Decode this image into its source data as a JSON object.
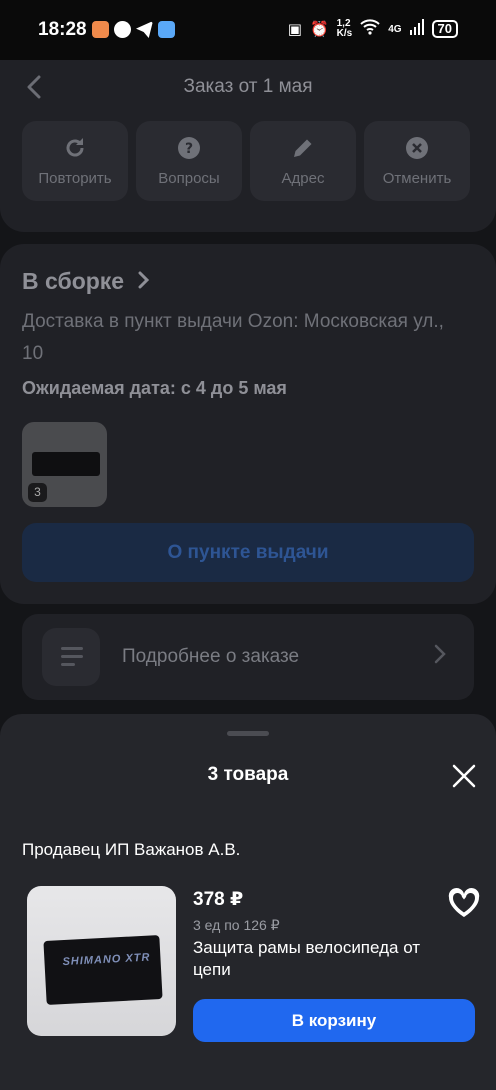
{
  "status_bar": {
    "time": "18:28",
    "network_speed": "1,2\nK/s",
    "network_type": "4G",
    "battery": "70"
  },
  "header": {
    "title": "Заказ от 1 мая"
  },
  "actions": [
    {
      "label": "Повторить",
      "icon": "repeat-icon"
    },
    {
      "label": "Вопросы",
      "icon": "question-icon"
    },
    {
      "label": "Адрес",
      "icon": "pencil-icon"
    },
    {
      "label": "Отменить",
      "icon": "cancel-icon"
    }
  ],
  "order_status": {
    "title": "В сборке",
    "delivery": "Доставка в пункт выдачи Ozon: Московская ул., 10",
    "expected_date": "Ожидаемая дата: с 4 до 5 мая",
    "item_count_badge": "3",
    "pickup_button": "О пункте выдачи"
  },
  "details": {
    "label": "Подробнее о заказе"
  },
  "sheet": {
    "title": "3 товара",
    "seller": "Продавец ИП Важанов А.В.",
    "product": {
      "price": "378 ₽",
      "unit_price": "3 ед по 126 ₽",
      "name": "Защита рамы велосипеда от цепи",
      "image_brand": "SHIMANO XTR"
    },
    "cart_button": "В корзину"
  },
  "colors": {
    "accent": "#2068ef",
    "sheet_bg": "#25262b",
    "page_bg": "#141518"
  }
}
